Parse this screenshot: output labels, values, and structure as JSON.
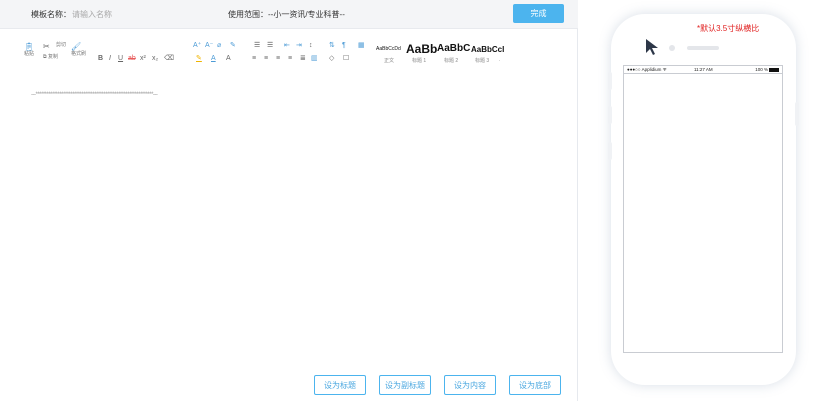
{
  "header": {
    "template_name_label": "模板名称：",
    "template_name_placeholder": "请输入名称",
    "scope_label": "使用范围：",
    "scope_value": "--小一资讯/专业科普--",
    "done_button": "完成"
  },
  "toolbar": {
    "group1": [
      {
        "icon": "paste-icon",
        "label": "粘贴"
      },
      {
        "icon": "cut-icon",
        "label": "剪切"
      },
      {
        "icon": "copy-icon",
        "label": "复制"
      },
      {
        "icon": "format-painter-icon",
        "label": "格式刷"
      }
    ],
    "style_samples": [
      {
        "sample": "AaBbCcDd",
        "caption": "正文"
      },
      {
        "sample": "AaBb",
        "caption": "标题 1"
      },
      {
        "sample": "AaBbC",
        "caption": "标题 2"
      },
      {
        "sample": "AaBbCcI",
        "caption": "标题 3"
      }
    ],
    "more_glyph": "."
  },
  "content": {
    "placeholder_line": "---****************************************************************---"
  },
  "actions": [
    {
      "label": "设为标题"
    },
    {
      "label": "设为副标题"
    },
    {
      "label": "设为内容"
    },
    {
      "label": "设为底部"
    }
  ],
  "phone": {
    "note": "*默认3.5寸纵横比",
    "status_carrier": "●●●○○ Applidium ᯤ",
    "status_time": "11:27 AM",
    "status_battery": "100 %"
  },
  "colors": {
    "accent": "#4cb4ee",
    "note_red": "#e02020"
  }
}
